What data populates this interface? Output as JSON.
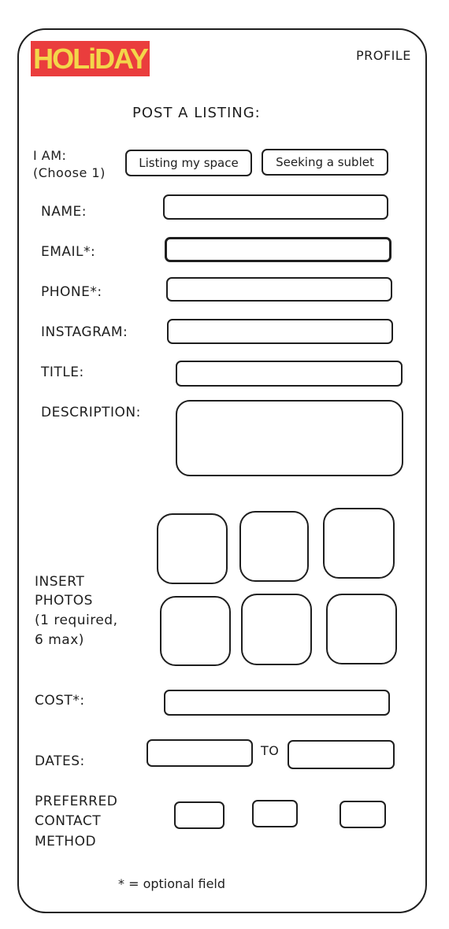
{
  "header": {
    "logo_text": "HOLiDAY",
    "profile_label": "PROFILE",
    "colors": {
      "logo_bg": "#ea3d3d",
      "logo_text": "#f3d64a"
    }
  },
  "form": {
    "title": "POST A LISTING:",
    "i_am_label_line1": "I AM:",
    "i_am_label_line2": "(Choose 1)",
    "option_listing": "Listing my space",
    "option_seeking": "Seeking a sublet",
    "name_label": "NAME:",
    "email_label": "EMAIL*:",
    "phone_label": "PHONE*:",
    "instagram_label": "INSTAGRAM:",
    "title_label": "TITLE:",
    "description_label": "DESCRIPTION:",
    "photos_label_line1": "INSERT",
    "photos_label_line2": "PHOTOS",
    "photos_label_line3": "(1 required,",
    "photos_label_line4": "6 max)",
    "cost_label": "COST*:",
    "dates_label": "DATES:",
    "dates_to": "TO",
    "contact_label_line1": "PREFERRED",
    "contact_label_line2": "CONTACT",
    "contact_label_line3": "METHOD",
    "footnote": "* = optional field"
  }
}
